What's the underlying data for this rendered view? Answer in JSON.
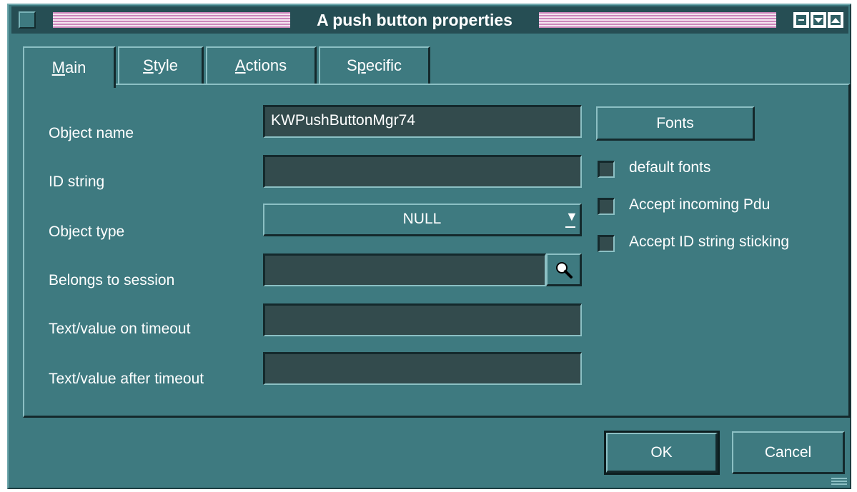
{
  "window": {
    "title": "A push button properties"
  },
  "tabs": [
    {
      "label": "Main",
      "mnemonic": "M",
      "rest": "ain",
      "active": true
    },
    {
      "label": "Style",
      "mnemonic": "S",
      "rest": "tyle",
      "active": false
    },
    {
      "label": "Actions",
      "mnemonic": "A",
      "rest": "ctions",
      "active": false
    },
    {
      "label": "Specific",
      "mnemonic_pre": "S",
      "mnemonic": "p",
      "rest": "ecific",
      "active": false
    }
  ],
  "form": {
    "object_name_label": "Object name",
    "object_name_value": "KWPushButtonMgr74",
    "id_string_label": "ID string",
    "id_string_value": "",
    "object_type_label": "Object type",
    "object_type_value": "NULL",
    "belongs_label": "Belongs to session",
    "belongs_value": "",
    "text_on_timeout_label": "Text/value on timeout",
    "text_on_timeout_value": "",
    "text_after_timeout_label": "Text/value after timeout",
    "text_after_timeout_value": ""
  },
  "side": {
    "fonts_button": "Fonts",
    "default_fonts_label": "default fonts",
    "accept_pdu_label": "Accept incoming Pdu",
    "accept_id_label": "Accept ID string sticking"
  },
  "dialog_buttons": {
    "ok": "OK",
    "cancel": "Cancel"
  },
  "icons": {
    "system_menu": "system-menu-icon",
    "minimize": "minimize-icon",
    "maximize": "maximize-icon",
    "close": "close-icon",
    "search": "magnifier-icon",
    "combo_arrow": "dropdown-arrow-icon"
  },
  "colors": {
    "window_bg": "#3e7a80",
    "titlebar_bg": "#264e54",
    "field_bg": "#334b4d",
    "stripe_pink": "#cc86bb"
  }
}
